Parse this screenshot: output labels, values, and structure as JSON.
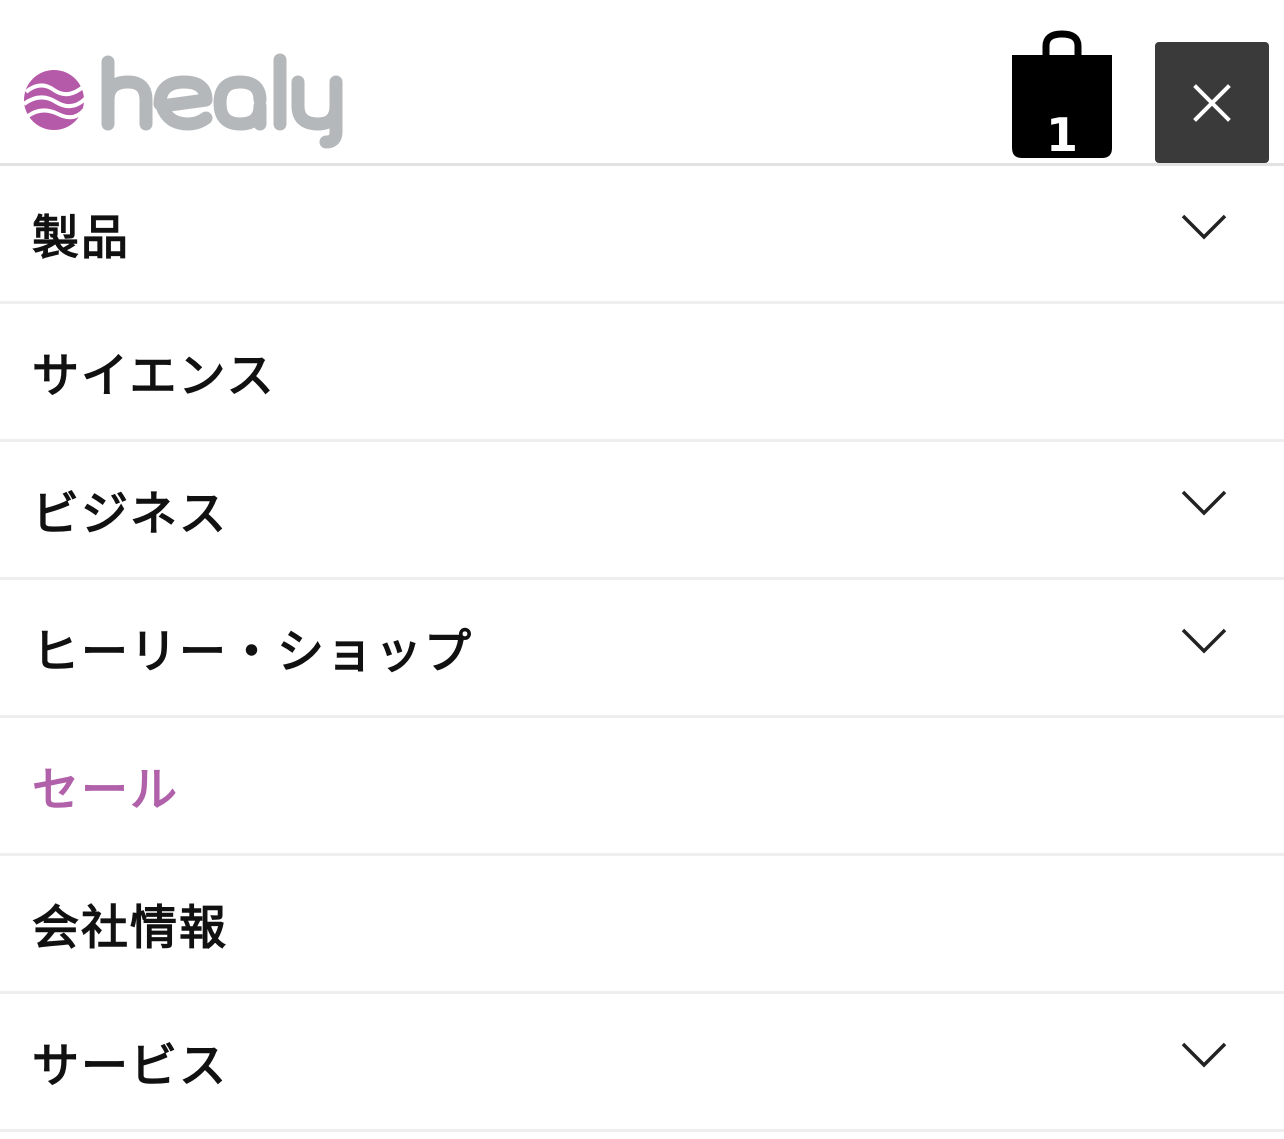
{
  "brand": {
    "name": "healy",
    "logo_colors": {
      "mark": "#b55aa8",
      "text": "#b4b8ba"
    }
  },
  "header": {
    "cart": {
      "icon": "shopping-bag-icon",
      "count": "1"
    },
    "close": {
      "icon": "close-icon"
    }
  },
  "menu": {
    "items": [
      {
        "label": "製品",
        "has_submenu": true
      },
      {
        "label": "サイエンス",
        "has_submenu": false
      },
      {
        "label": "ビジネス",
        "has_submenu": true
      },
      {
        "label": "ヒーリー・ショップ",
        "has_submenu": true
      },
      {
        "label": "セール",
        "has_submenu": false,
        "highlight_color": "#b061aa"
      },
      {
        "label": "会社情報",
        "has_submenu": false
      },
      {
        "label": "サービス",
        "has_submenu": true
      }
    ]
  }
}
